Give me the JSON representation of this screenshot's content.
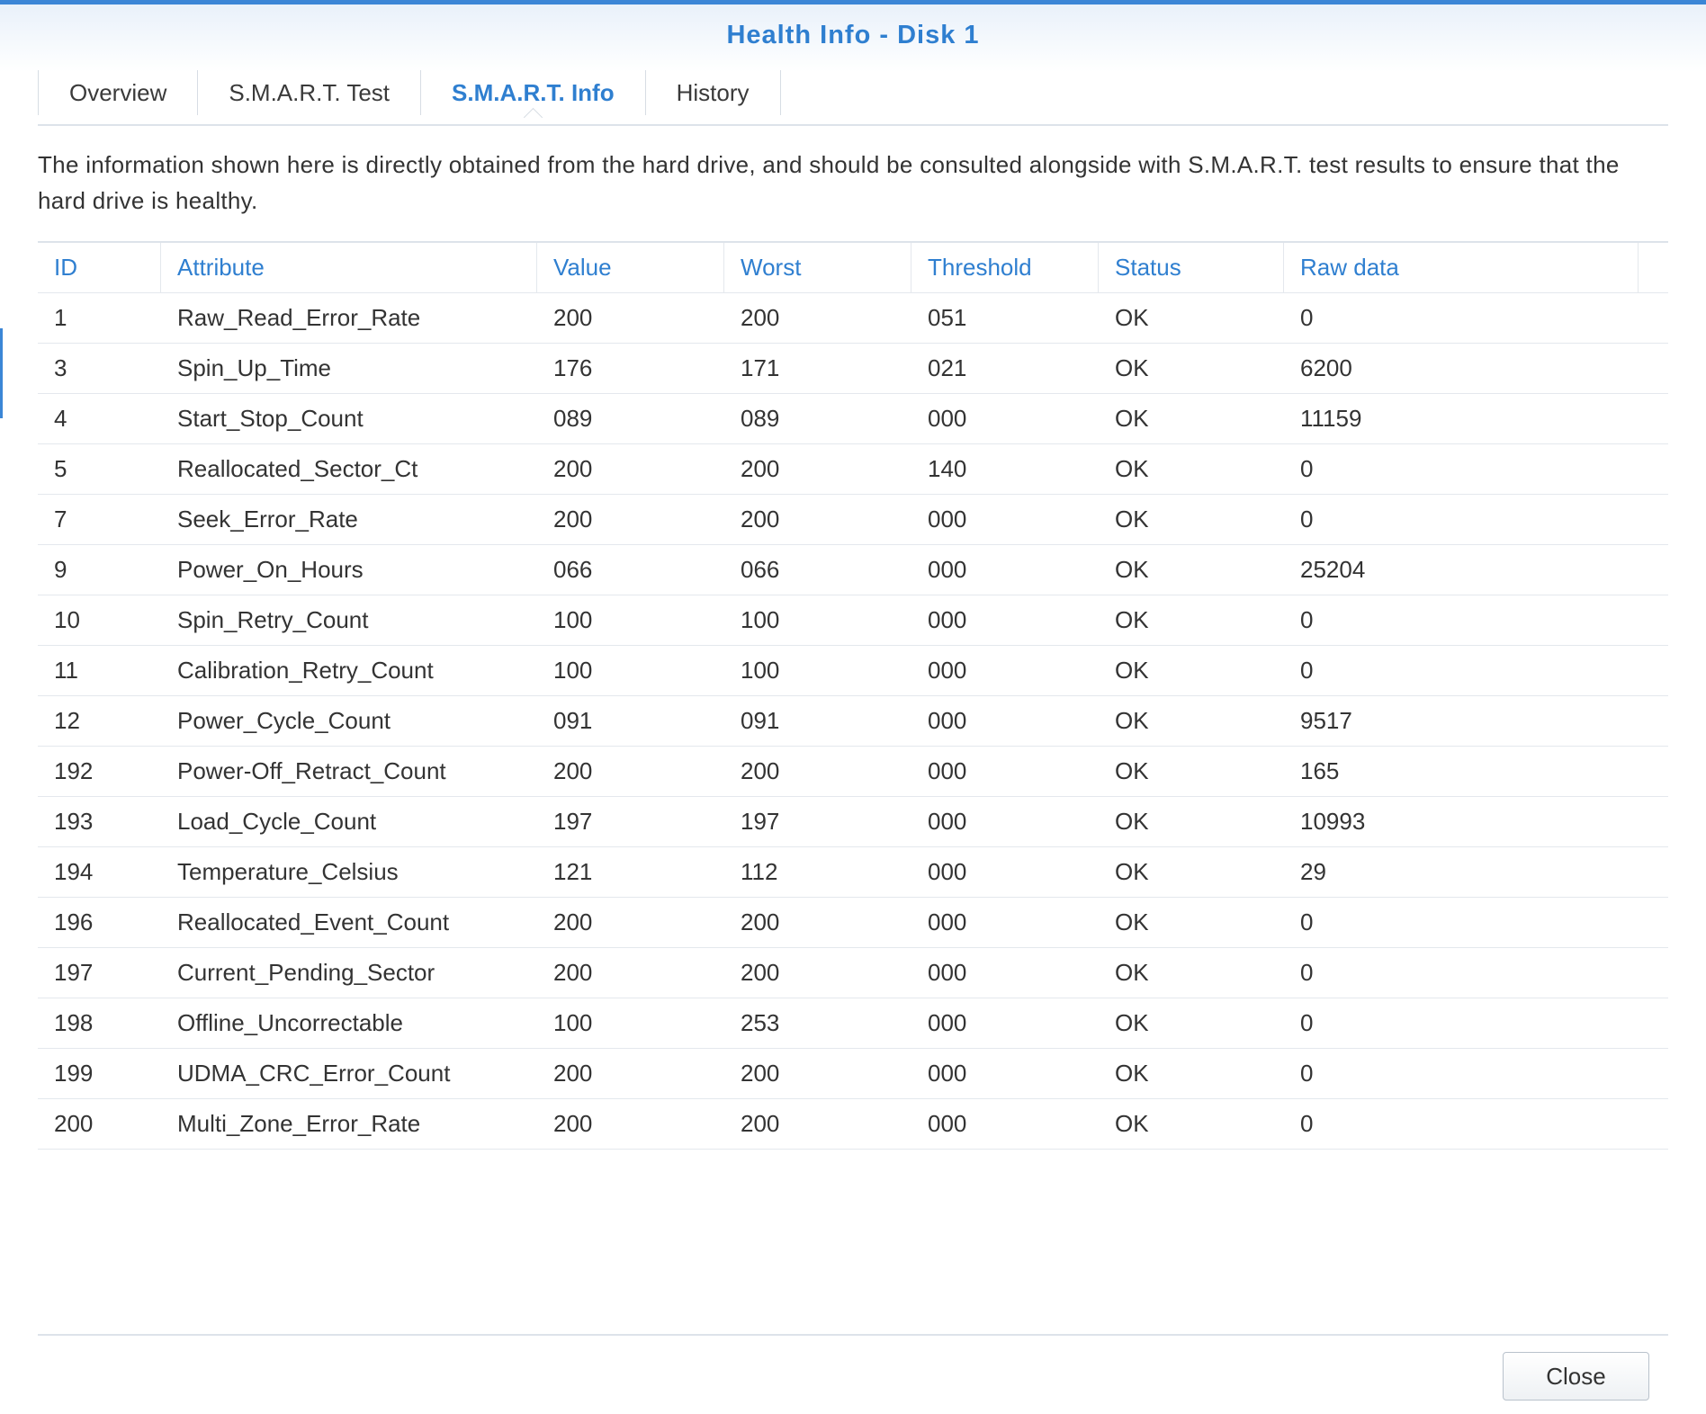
{
  "window": {
    "title": "Health Info - Disk 1"
  },
  "tabs": [
    {
      "label": "Overview",
      "active": false
    },
    {
      "label": "S.M.A.R.T. Test",
      "active": false
    },
    {
      "label": "S.M.A.R.T. Info",
      "active": true
    },
    {
      "label": "History",
      "active": false
    }
  ],
  "description": "The information shown here is directly obtained from the hard drive, and should be consulted alongside with S.M.A.R.T. test results to ensure that the hard drive is healthy.",
  "table": {
    "columns": [
      "ID",
      "Attribute",
      "Value",
      "Worst",
      "Threshold",
      "Status",
      "Raw data"
    ],
    "rows": [
      [
        "1",
        "Raw_Read_Error_Rate",
        "200",
        "200",
        "051",
        "OK",
        "0"
      ],
      [
        "3",
        "Spin_Up_Time",
        "176",
        "171",
        "021",
        "OK",
        "6200"
      ],
      [
        "4",
        "Start_Stop_Count",
        "089",
        "089",
        "000",
        "OK",
        "11159"
      ],
      [
        "5",
        "Reallocated_Sector_Ct",
        "200",
        "200",
        "140",
        "OK",
        "0"
      ],
      [
        "7",
        "Seek_Error_Rate",
        "200",
        "200",
        "000",
        "OK",
        "0"
      ],
      [
        "9",
        "Power_On_Hours",
        "066",
        "066",
        "000",
        "OK",
        "25204"
      ],
      [
        "10",
        "Spin_Retry_Count",
        "100",
        "100",
        "000",
        "OK",
        "0"
      ],
      [
        "11",
        "Calibration_Retry_Count",
        "100",
        "100",
        "000",
        "OK",
        "0"
      ],
      [
        "12",
        "Power_Cycle_Count",
        "091",
        "091",
        "000",
        "OK",
        "9517"
      ],
      [
        "192",
        "Power-Off_Retract_Count",
        "200",
        "200",
        "000",
        "OK",
        "165"
      ],
      [
        "193",
        "Load_Cycle_Count",
        "197",
        "197",
        "000",
        "OK",
        "10993"
      ],
      [
        "194",
        "Temperature_Celsius",
        "121",
        "112",
        "000",
        "OK",
        "29"
      ],
      [
        "196",
        "Reallocated_Event_Count",
        "200",
        "200",
        "000",
        "OK",
        "0"
      ],
      [
        "197",
        "Current_Pending_Sector",
        "200",
        "200",
        "000",
        "OK",
        "0"
      ],
      [
        "198",
        "Offline_Uncorrectable",
        "100",
        "253",
        "000",
        "OK",
        "0"
      ],
      [
        "199",
        "UDMA_CRC_Error_Count",
        "200",
        "200",
        "000",
        "OK",
        "0"
      ],
      [
        "200",
        "Multi_Zone_Error_Rate",
        "200",
        "200",
        "000",
        "OK",
        "0"
      ]
    ]
  },
  "footer": {
    "close_label": "Close"
  },
  "colors": {
    "accent": "#2f7fd0",
    "text": "#333333",
    "border": "#dde3ea"
  }
}
